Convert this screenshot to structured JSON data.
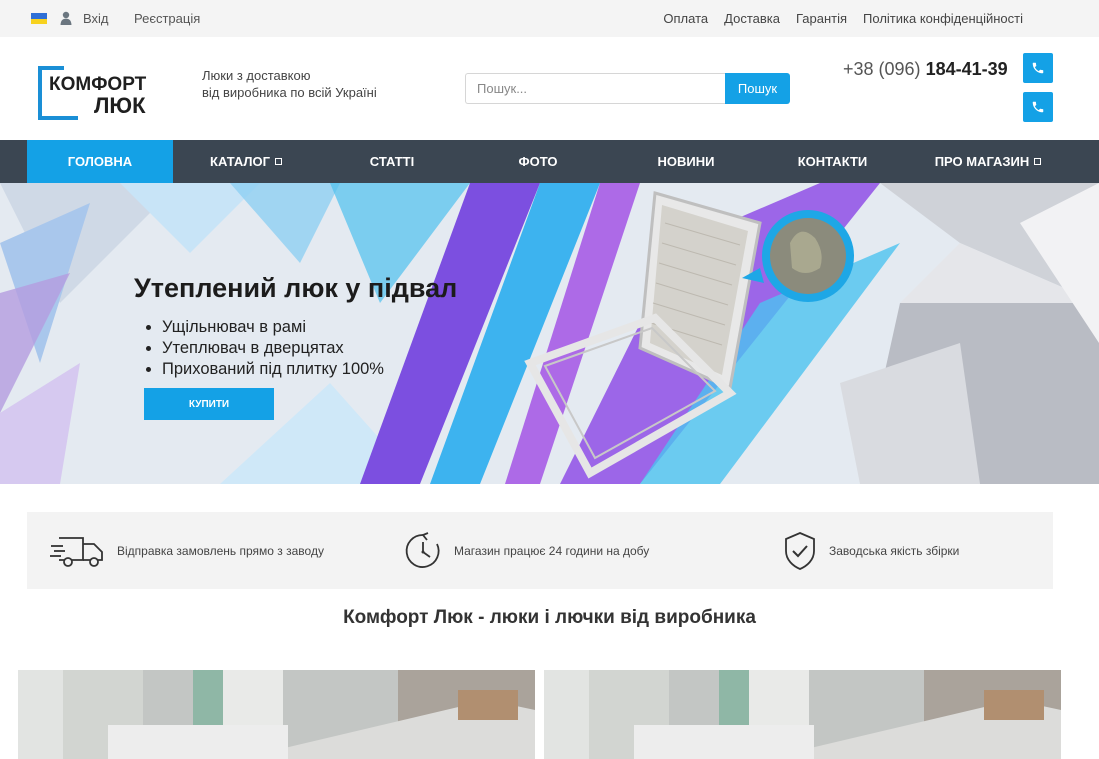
{
  "topbar": {
    "login": "Вхід",
    "register": "Реєстрація",
    "links": [
      "Оплата",
      "Доставка",
      "Гарантія",
      "Політика конфіденційності"
    ]
  },
  "header": {
    "logo_line1": "КОМФОРТ",
    "logo_line2": "ЛЮК",
    "tagline_line1": "Люки з доставкою",
    "tagline_line2": "від виробника по всій Україні",
    "search_placeholder": "Пошук...",
    "search_button": "Пошук",
    "phone_prefix": "+38 (096) ",
    "phone_number": "184-41-39"
  },
  "nav": {
    "items": [
      "ГОЛОВНА",
      "КАТАЛОГ",
      "СТАТТІ",
      "ФОТО",
      "НОВИНИ",
      "КОНТАКТИ",
      "ПРО МАГАЗИН"
    ],
    "active_index": 0
  },
  "hero": {
    "title": "Утеплений люк у підвал",
    "bullets": [
      "Ущільнювач в рамі",
      "Утеплювач в дверцятах",
      "Прихований під плитку 100%"
    ],
    "button": "КУПИТИ"
  },
  "features": [
    {
      "icon": "truck-icon",
      "text": "Відправка замовлень прямо з заводу"
    },
    {
      "icon": "clock-icon",
      "text": "Магазин працює 24 години на добу"
    },
    {
      "icon": "shield-check-icon",
      "text": "Заводська якість збірки"
    }
  ],
  "section_title": "Комфорт Люк - люки і лючки від виробника",
  "colors": {
    "accent": "#14a1e6",
    "nav_bg": "#3b4652",
    "topbar_bg": "#f4f4f4",
    "features_bg": "#f3f3f3"
  }
}
